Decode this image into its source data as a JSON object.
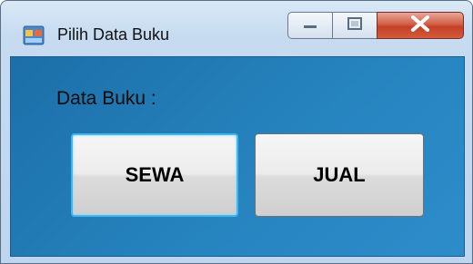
{
  "window": {
    "title": "Pilih Data Buku",
    "controls": {
      "minimize": "minimize",
      "maximize": "maximize",
      "close": "close"
    }
  },
  "form": {
    "label": "Data Buku :",
    "buttons": [
      {
        "label": "SEWA",
        "focused": true
      },
      {
        "label": "JUAL",
        "focused": false
      }
    ]
  },
  "colors": {
    "panel": "#2683be",
    "close": "#c24127",
    "focus": "#3fb8f0"
  }
}
